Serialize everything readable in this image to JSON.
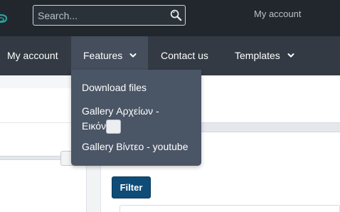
{
  "header": {
    "search": {
      "placeholder": "Search...",
      "value": ""
    },
    "account_link": "My account"
  },
  "nav": {
    "items": [
      {
        "label": "My account"
      },
      {
        "label": "Features"
      },
      {
        "label": "Contact us"
      },
      {
        "label": "Templates"
      }
    ]
  },
  "dropdown": {
    "items": [
      {
        "label": "Download files"
      },
      {
        "label": "Gallery Αρχείων - Εικόνων"
      },
      {
        "label": "Gallery Βίντεο - youtube"
      }
    ]
  },
  "main": {
    "filter_label": "Filter"
  },
  "colors": {
    "topbar": "#22272e",
    "navbar": "#333a44",
    "nav_active": "#454e5c",
    "dropdown": "#4a5566",
    "filter_button": "#0f4c77",
    "logo_accent": "#2aa39a"
  }
}
